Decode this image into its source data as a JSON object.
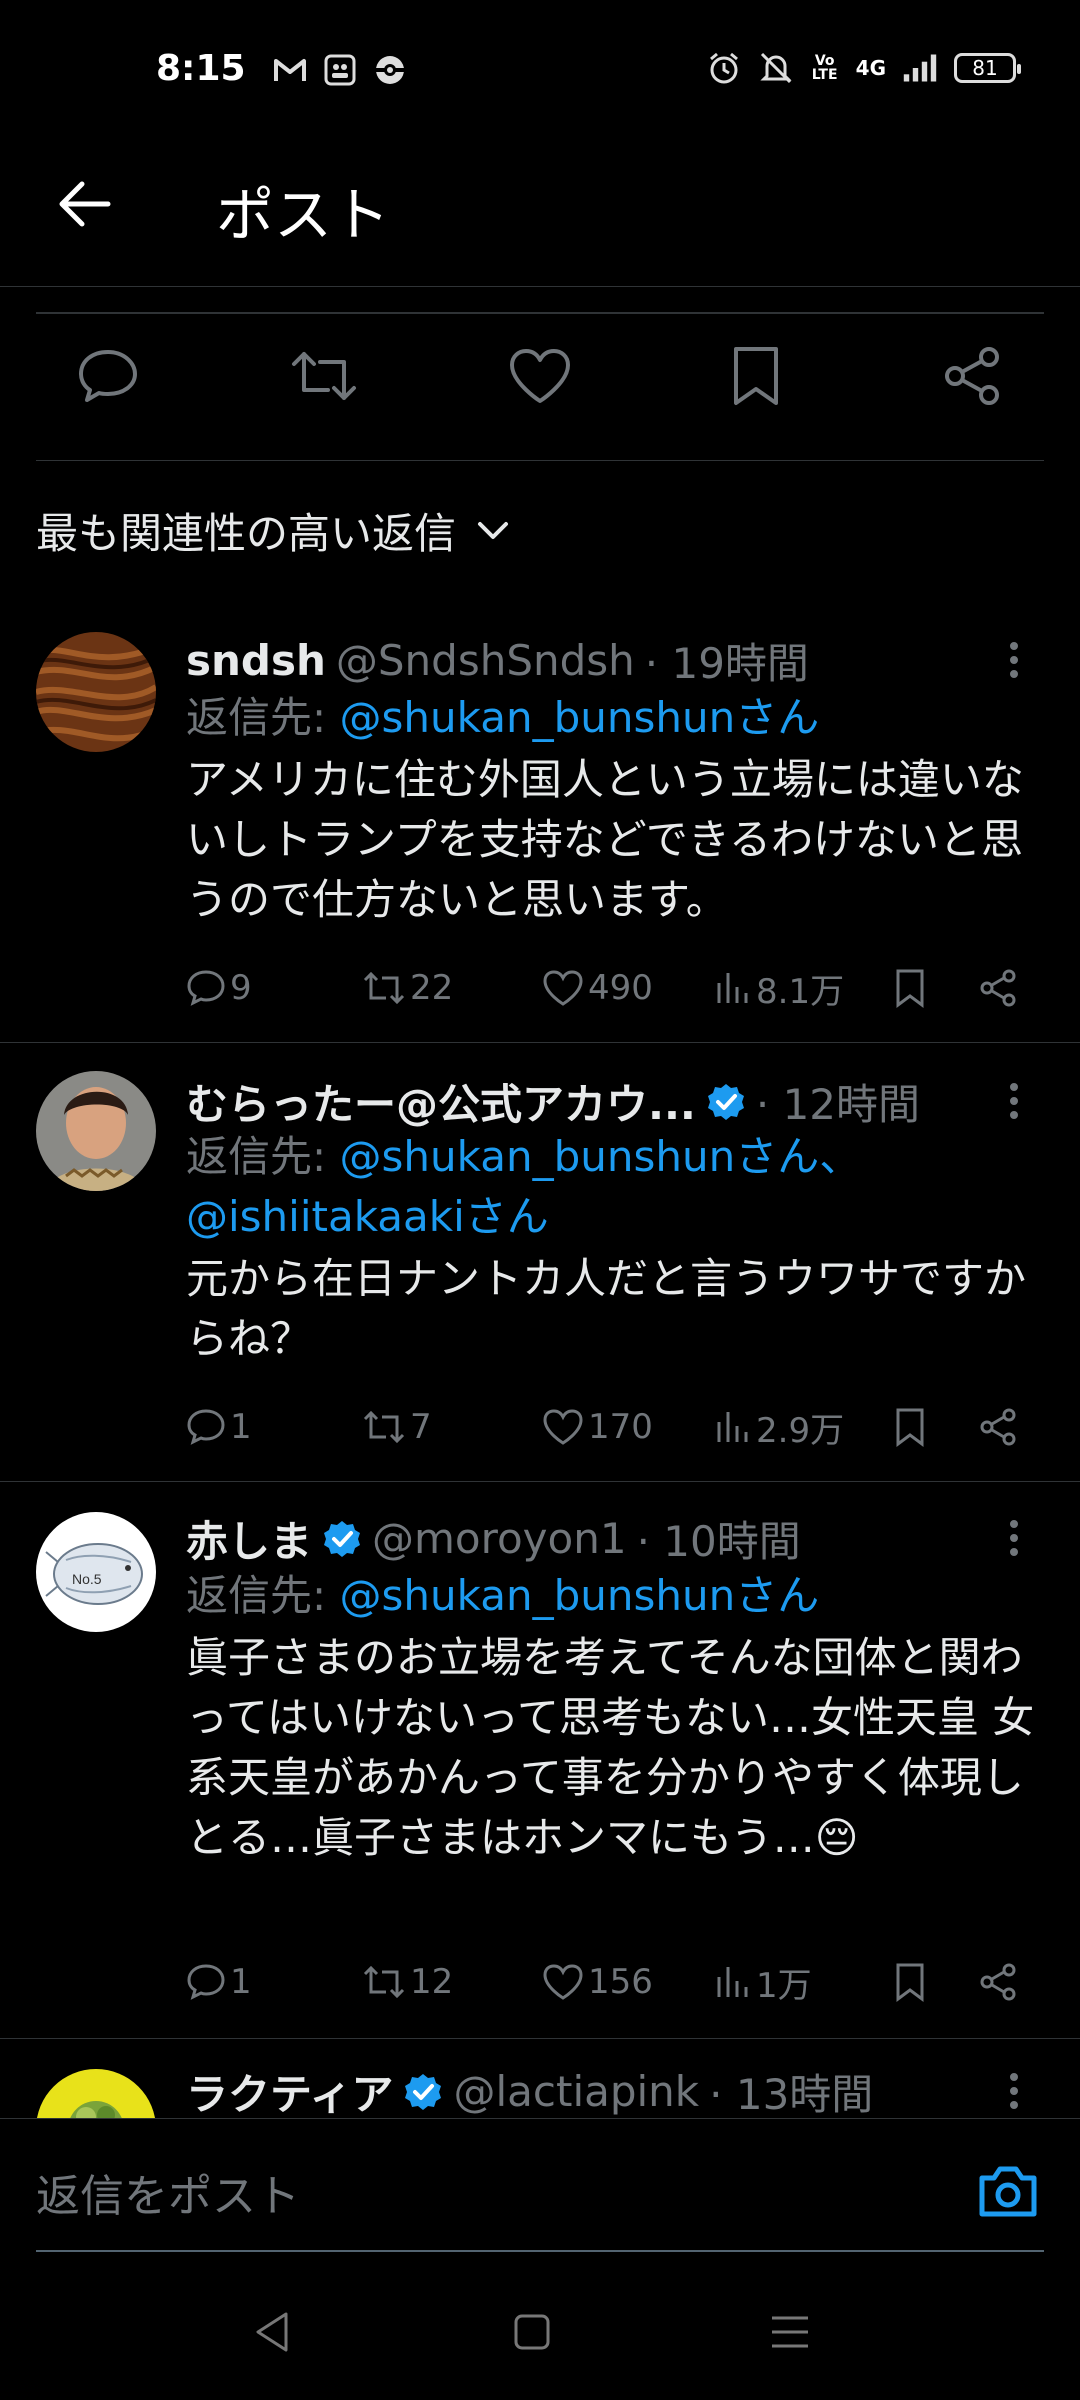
{
  "status_bar": {
    "time": "8:15",
    "left_icons": [
      "gmail-icon",
      "notification-icon",
      "pokeball-icon"
    ],
    "right_icons": [
      "alarm-icon",
      "mute-icon",
      "volte-icon",
      "signal-icon"
    ],
    "volte": "Vo LTE",
    "network": "4G",
    "battery": "81"
  },
  "header": {
    "title": "ポスト"
  },
  "actions": [
    "reply-icon",
    "retweet-icon",
    "like-icon",
    "bookmark-icon",
    "share-icon"
  ],
  "sort": {
    "label": "最も関連性の高い返信"
  },
  "replies": [
    {
      "name": "sndsh",
      "verified": false,
      "handle": "@SndshSndsh",
      "time": "· 19時間",
      "reply_prefix": "返信先: ",
      "reply_to_line1": "@shukan_bunshunさん",
      "reply_to_line2": "",
      "text": "アメリカに住む外国人という立場には違いないしトランプを支持などできるわけないと思うので仕方ないと思います。",
      "replies": "9",
      "retweets": "22",
      "likes": "490",
      "views": "8.1万"
    },
    {
      "name": "むらったー@公式アカウ...",
      "verified": true,
      "handle": "",
      "time": "· 12時間",
      "reply_prefix": "返信先: ",
      "reply_to_line1": "@shukan_bunshunさん、",
      "reply_to_line2": "@ishiitakaakiさん",
      "text": "元から在日ナントカ人だと言うウワサですからね？",
      "replies": "1",
      "retweets": "7",
      "likes": "170",
      "views": "2.9万"
    },
    {
      "name": "赤しま",
      "verified": true,
      "handle": "@moroyon1",
      "time": "· 10時間",
      "reply_prefix": "返信先: ",
      "reply_to_line1": "@shukan_bunshunさん",
      "reply_to_line2": "",
      "text": "眞子さまのお立場を考えてそんな団体と関わってはいけないって思考もない…女性天皇 女系天皇があかんって事を分かりやすく体現しとる…眞子さまはホンマにもう…😔",
      "replies": "1",
      "retweets": "12",
      "likes": "156",
      "views": "1万"
    },
    {
      "name": "ラクティア",
      "verified": true,
      "handle": "@lactiapink",
      "time": "· 13時間"
    }
  ],
  "avatar_labels": {
    "third": "No.5"
  },
  "reply_box": {
    "placeholder": "返信をポスト"
  },
  "nav": [
    "back-nav-icon",
    "home-nav-icon",
    "menu-nav-icon"
  ],
  "colors": {
    "accent": "#1d9bf0",
    "muted": "#71767b",
    "text": "#e7e9ea",
    "bg": "#000000"
  }
}
